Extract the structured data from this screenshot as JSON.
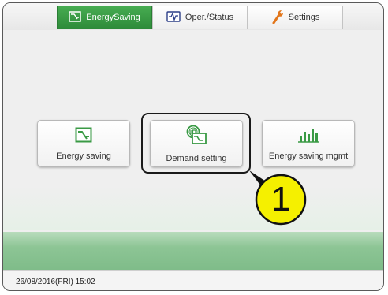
{
  "tabs": [
    {
      "label": "EnergySaving",
      "icon": "energy-saving-icon",
      "active": true
    },
    {
      "label": "Oper./Status",
      "icon": "waveform-icon",
      "active": false
    },
    {
      "label": "Settings",
      "icon": "wrench-icon",
      "active": false
    }
  ],
  "menu": [
    {
      "label": "Energy saving",
      "icon": "energy-saving-icon"
    },
    {
      "label": "Demand setting",
      "icon": "demand-setting-icon"
    },
    {
      "label": "Energy saving mgmt",
      "icon": "bar-chart-icon"
    }
  ],
  "callout": {
    "number": "1"
  },
  "status": {
    "datetime": "26/08/2016(FRI) 15:02"
  },
  "colors": {
    "accent_green": "#3a9a45",
    "callout_yellow": "#f5f000",
    "band_green": "#8dc595"
  }
}
